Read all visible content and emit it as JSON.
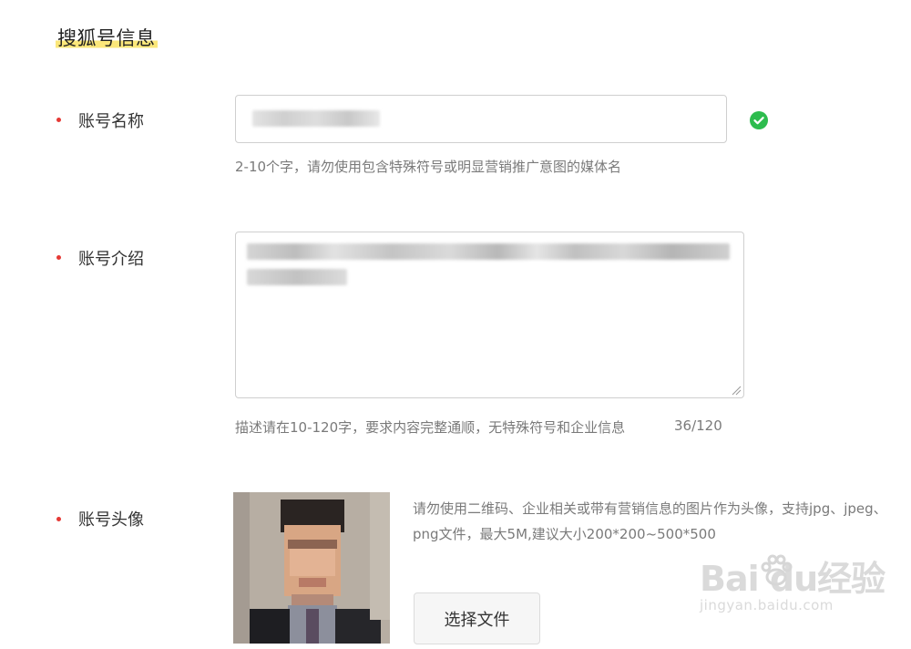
{
  "section": {
    "title": "搜狐号信息"
  },
  "fields": {
    "name": {
      "label": "账号名称",
      "hint": "2-10个字，请勿使用包含特殊符号或明显营销推广意图的媒体名"
    },
    "intro": {
      "label": "账号介绍",
      "hint": "描述请在10-120字，要求内容完整通顺，无特殊符号和企业信息",
      "counter": "36/120"
    },
    "avatar": {
      "label": "账号头像",
      "hint": "请勿使用二维码、企业相关或带有营销信息的图片作为头像，支持jpg、jpeg、png文件，最大5M,建议大小200*200~500*500",
      "button_label": "选择文件"
    }
  },
  "watermark": {
    "main": "Bai  du经验",
    "sub": "jingyan.baidu.com"
  },
  "colors": {
    "required_dot": "#e53935",
    "check": "#2dbc4e",
    "title_highlight": "#fbe77a"
  },
  "icons": {
    "valid": "check-circle-icon",
    "resize": "resize-handle-icon"
  }
}
